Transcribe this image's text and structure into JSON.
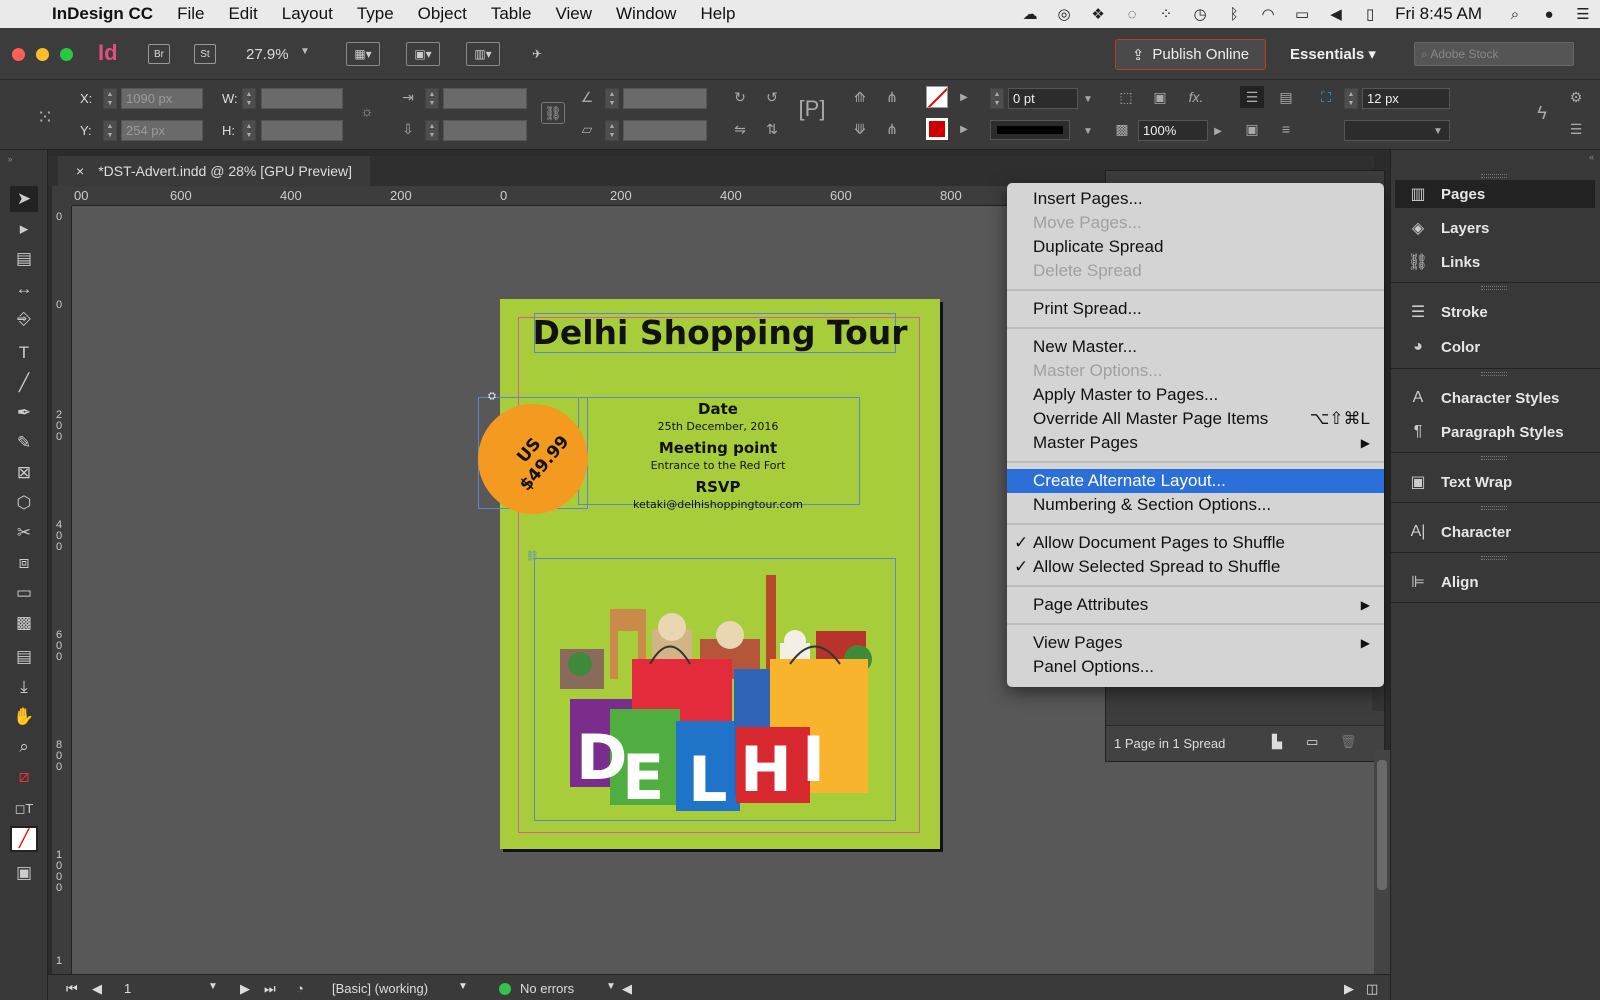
{
  "menubar": {
    "app_name": "InDesign CC",
    "items": [
      "File",
      "Edit",
      "Layout",
      "Type",
      "Object",
      "Table",
      "View",
      "Window",
      "Help"
    ],
    "clock": "Fri 8:45 AM"
  },
  "appbar": {
    "app_logo": "Id",
    "bridge": "Br",
    "stock_btn": "St",
    "zoom": "27.9%",
    "publish": "Publish Online",
    "workspace": "Essentials",
    "search_placeholder": "Adobe Stock"
  },
  "control": {
    "x_label": "X:",
    "y_label": "Y:",
    "w_label": "W:",
    "h_label": "H:",
    "x_value": "1090 px",
    "y_value": "254 px",
    "stroke_weight": "0 pt",
    "opacity": "100%",
    "offset": "12 px"
  },
  "document": {
    "tab_title": "*DST-Advert.indd @ 28% [GPU Preview]",
    "close": "×"
  },
  "ruler": {
    "h_ticks": [
      "00",
      "600",
      "400",
      "200",
      "0",
      "200",
      "400",
      "600",
      "800"
    ],
    "v_ticks": [
      "0",
      "0",
      "200",
      "400",
      "600",
      "800",
      "1000",
      "1"
    ]
  },
  "advert": {
    "title": "Delhi Shopping Tour",
    "date_heading": "Date",
    "date_value": "25th December, 2016",
    "meeting_heading": "Meeting point",
    "meeting_value": "Entrance to the Red Fort",
    "rsvp_heading": "RSVP",
    "rsvp_value": "ketaki@delhishoppingtour.com",
    "price_currency": "US",
    "price_value": "$49.99",
    "colors": {
      "background": "#a7ce3a",
      "price_circle": "#f49a21"
    }
  },
  "context_menu": {
    "items": [
      {
        "label": "Insert Pages...",
        "disabled": false
      },
      {
        "label": "Move Pages...",
        "disabled": true
      },
      {
        "label": "Duplicate Spread",
        "disabled": false
      },
      {
        "label": "Delete Spread",
        "disabled": true
      },
      {
        "label": "Print Spread...",
        "disabled": false
      },
      {
        "label": "New Master...",
        "disabled": false
      },
      {
        "label": "Master Options...",
        "disabled": true
      },
      {
        "label": "Apply Master to Pages...",
        "disabled": false
      },
      {
        "label": "Override All Master Page Items",
        "shortcut": "⌥⇧⌘L"
      },
      {
        "label": "Master Pages",
        "submenu": "▶"
      },
      {
        "label": "Create Alternate Layout...",
        "highlighted": true
      },
      {
        "label": "Numbering & Section Options..."
      },
      {
        "label": "Allow Document Pages to Shuffle",
        "checked": "✓"
      },
      {
        "label": "Allow Selected Spread to Shuffle",
        "checked": "✓"
      },
      {
        "label": "Page Attributes",
        "submenu": "▶"
      },
      {
        "label": "View Pages",
        "submenu": "▶"
      },
      {
        "label": "Panel Options..."
      }
    ],
    "highlight_color": "#2b6fd8"
  },
  "pages_panel": {
    "footer": "1 Page in 1 Spread"
  },
  "dock": {
    "items": [
      "Pages",
      "Layers",
      "Links",
      "Stroke",
      "Color",
      "Character Styles",
      "Paragraph Styles",
      "Text Wrap",
      "Character",
      "Align"
    ]
  },
  "statusbar": {
    "page_number": "1",
    "preflight_profile": "[Basic] (working)",
    "errors": "No errors"
  }
}
